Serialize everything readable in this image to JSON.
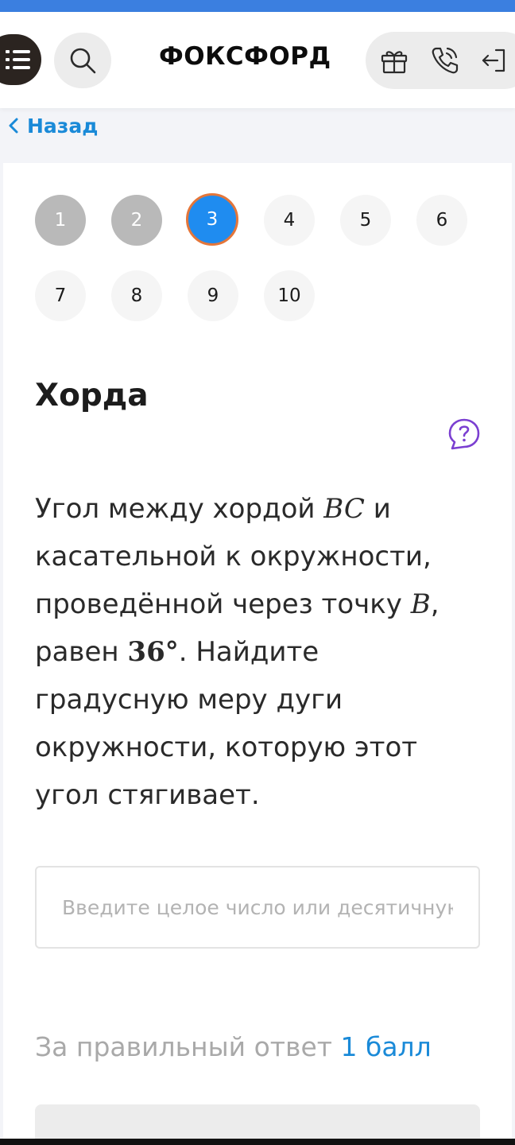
{
  "header": {
    "logo": "ФОКСФОРД",
    "menu_icon": "list-menu-icon",
    "search_icon": "search-icon",
    "actions": [
      "gift-icon",
      "phone-icon",
      "login-icon"
    ]
  },
  "nav": {
    "back_label": "Назад",
    "back_icon": "chevron-left-icon"
  },
  "pager": {
    "current": 3,
    "pages": [
      {
        "label": "1",
        "state": "done"
      },
      {
        "label": "2",
        "state": "done"
      },
      {
        "label": "3",
        "state": "current"
      },
      {
        "label": "4",
        "state": "pending"
      },
      {
        "label": "5",
        "state": "pending"
      },
      {
        "label": "6",
        "state": "pending"
      },
      {
        "label": "7",
        "state": "pending"
      },
      {
        "label": "8",
        "state": "pending"
      },
      {
        "label": "9",
        "state": "pending"
      },
      {
        "label": "10",
        "state": "pending"
      }
    ]
  },
  "task": {
    "title": "Хорда",
    "help_icon": "question-bubble-icon",
    "text": {
      "p1": "Угол между хордой ",
      "m1": "BC",
      "p2": " и касательной к окружности, проведённой через точку ",
      "m2": "B",
      "p3": ", равен ",
      "m3": "36°",
      "p4": ". Найдите градусную меру дуги окружности, которую этот угол стягивает."
    }
  },
  "answer": {
    "placeholder": "Введите целое число или десятичную дробь",
    "value": ""
  },
  "score": {
    "prefix": "За правильный ответ ",
    "value": "1 балл"
  },
  "colors": {
    "accent": "#1f8cf0",
    "link": "#1a8ad8",
    "current_ring": "#e4763a",
    "done": "#b9b9b9",
    "help": "#7b3fd1",
    "top_strip": "#3b7fe0"
  }
}
